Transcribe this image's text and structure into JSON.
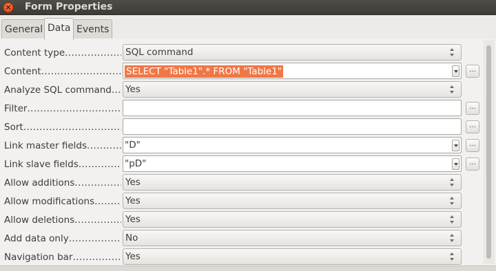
{
  "window": {
    "title": "Form Properties",
    "close_glyph": "×"
  },
  "tabs": [
    {
      "label": "General"
    },
    {
      "label": "Data"
    },
    {
      "label": "Events"
    }
  ],
  "active_tab": "Data",
  "accent_color": "#f07746",
  "more_button_label": "...",
  "properties": [
    {
      "label": "Content type",
      "dots": "...................",
      "kind": "combo",
      "value": "SQL command"
    },
    {
      "label": "Content",
      "dots": ".............................",
      "kind": "field-dropdown",
      "value": "SELECT \"Table1\".* FROM \"Table1\"",
      "selected": true,
      "more": true
    },
    {
      "label": "Analyze SQL command",
      "dots": "....",
      "kind": "combo",
      "value": "Yes"
    },
    {
      "label": "Filter",
      "dots": "......................................",
      "kind": "field",
      "value": "",
      "more": true
    },
    {
      "label": "Sort",
      "dots": ".........................................",
      "kind": "field",
      "value": "",
      "more": true
    },
    {
      "label": "Link master fields",
      "dots": "............",
      "kind": "field-dropdown",
      "value": "\"D\"",
      "more": true
    },
    {
      "label": "Link slave fields",
      "dots": "..............",
      "kind": "field-dropdown",
      "value": "\"pD\"",
      "more": true
    },
    {
      "label": "Allow additions",
      "dots": ".................",
      "kind": "combo",
      "value": "Yes"
    },
    {
      "label": "Allow modifications",
      "dots": "........",
      "kind": "combo",
      "value": "Yes"
    },
    {
      "label": "Allow deletions",
      "dots": "..................",
      "kind": "combo",
      "value": "Yes"
    },
    {
      "label": "Add data only",
      "dots": "......................",
      "kind": "combo",
      "value": "No"
    },
    {
      "label": "Navigation bar",
      "dots": "..................",
      "kind": "combo",
      "value": "Yes"
    }
  ]
}
